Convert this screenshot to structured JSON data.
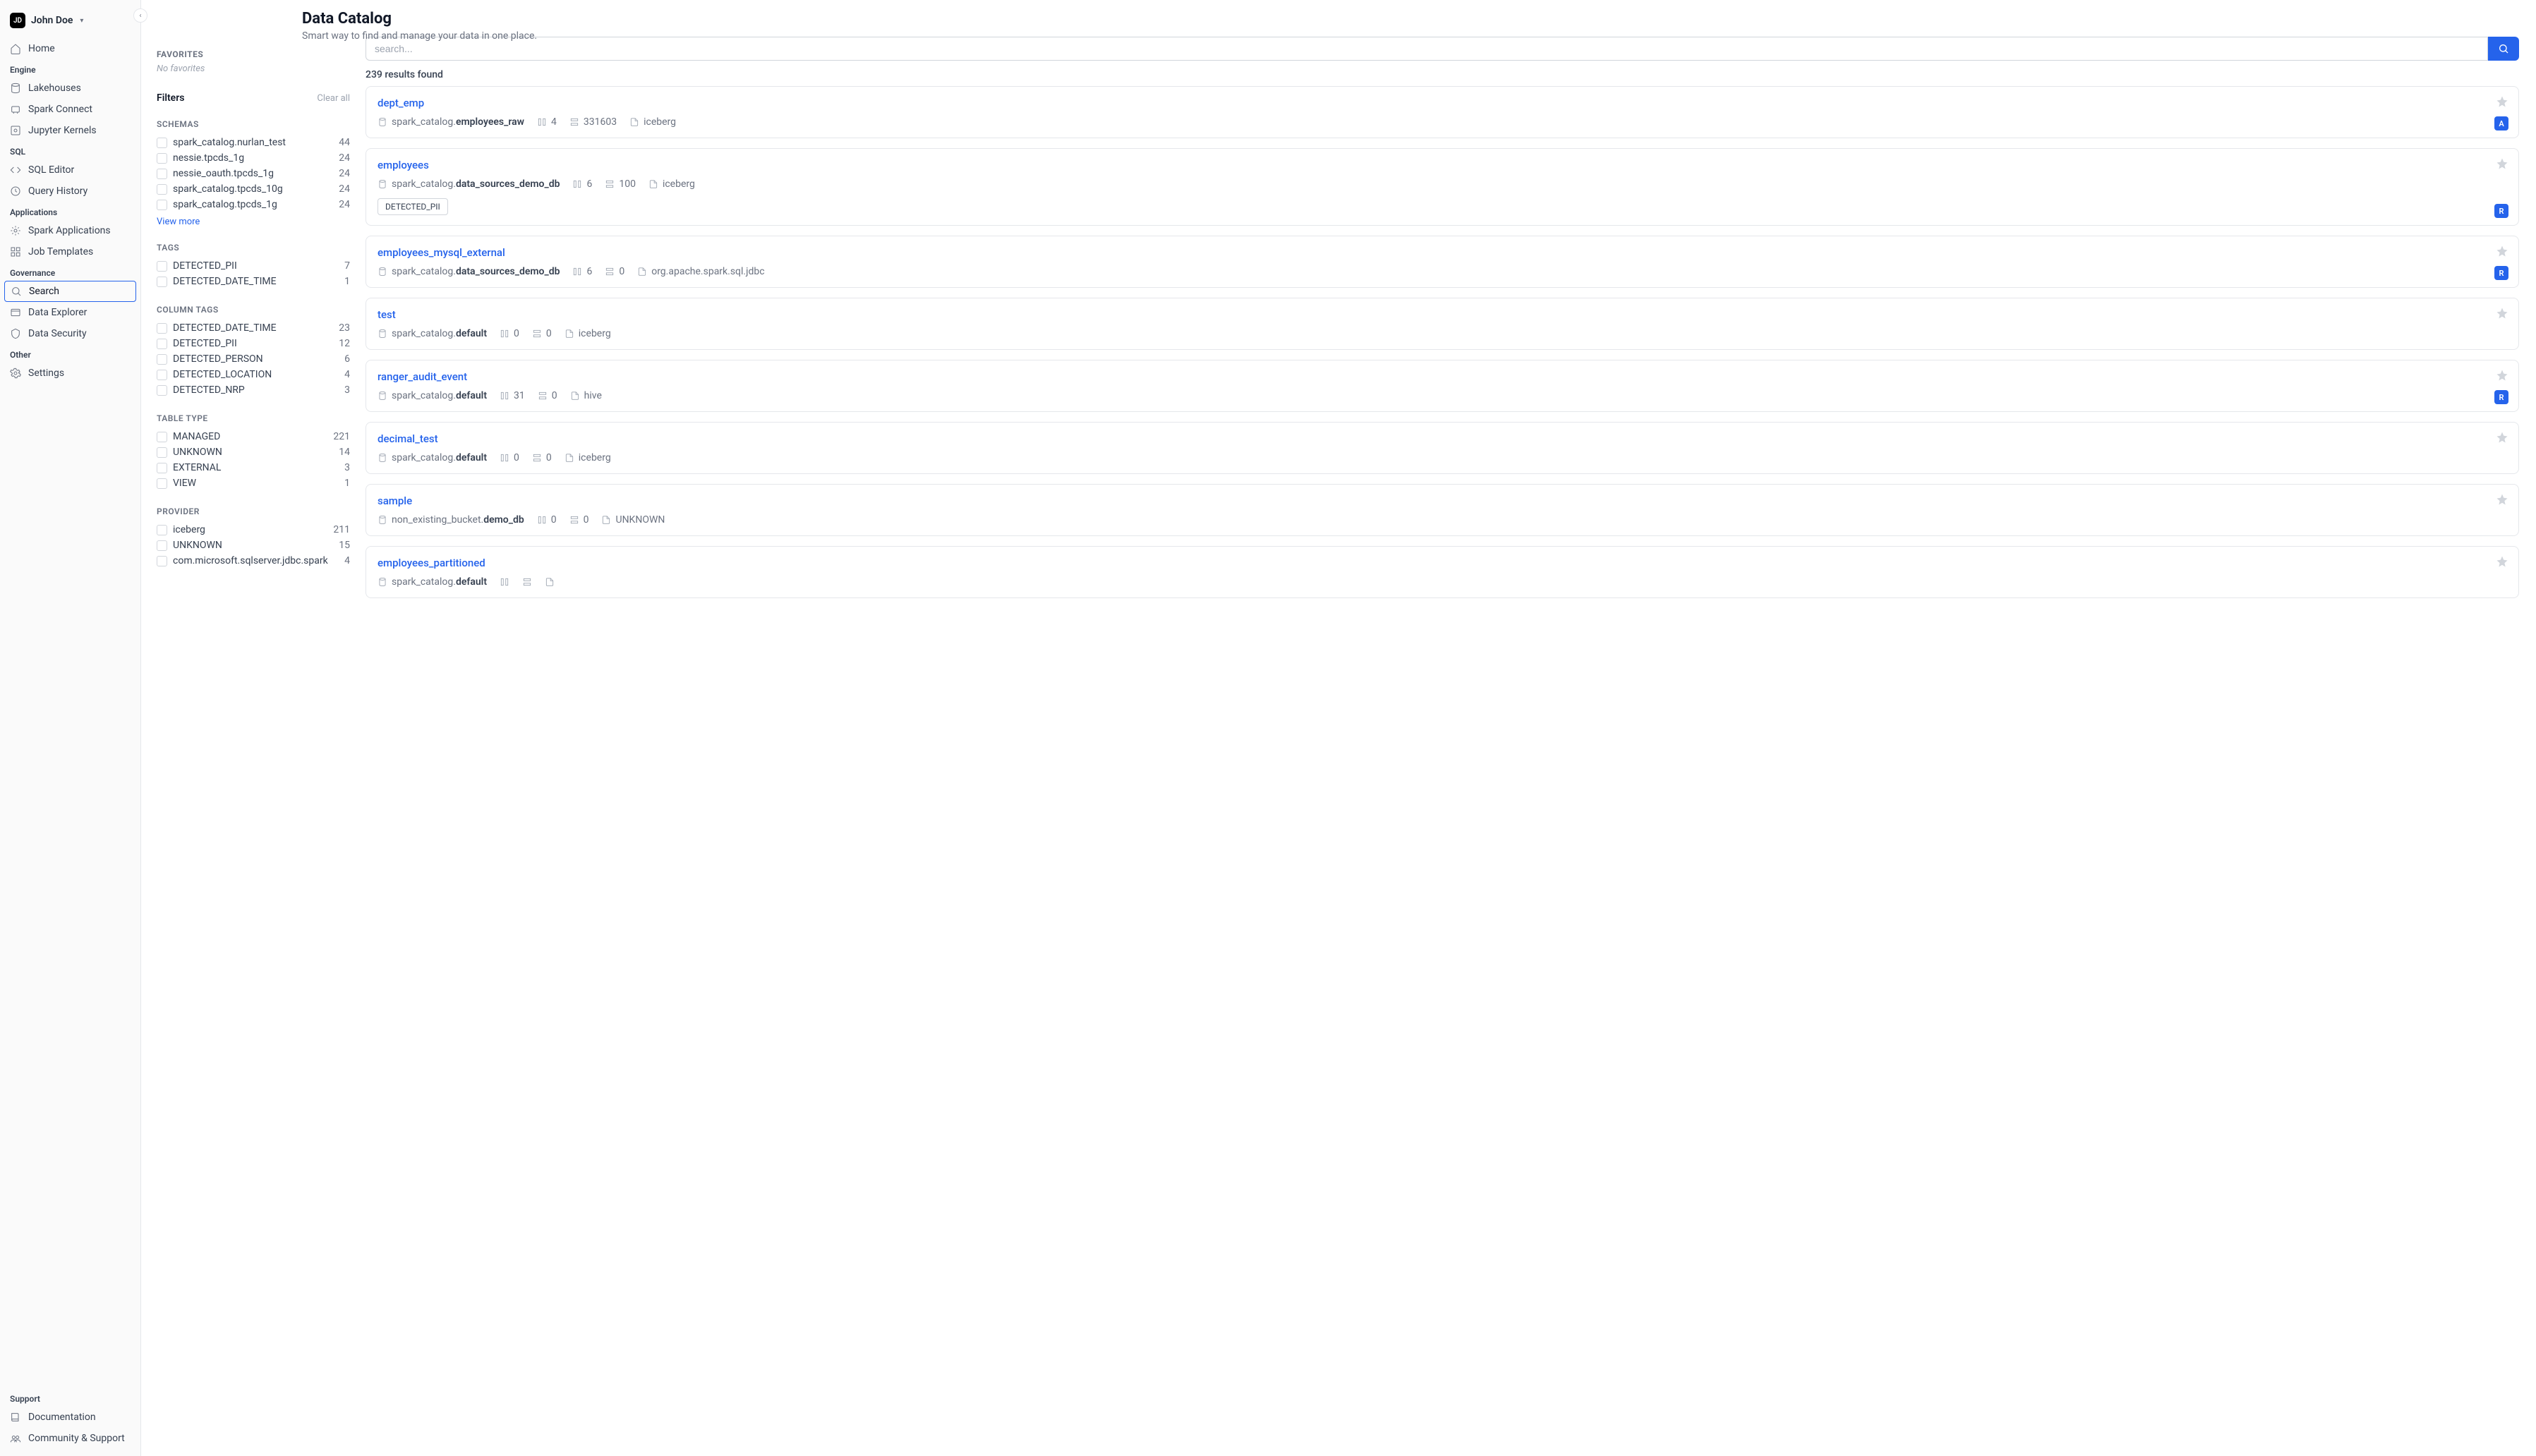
{
  "user": {
    "initials": "JD",
    "name": "John Doe"
  },
  "sidebar": {
    "home": "Home",
    "sections": {
      "engine": {
        "label": "Engine",
        "items": [
          {
            "label": "Lakehouses",
            "icon": "database"
          },
          {
            "label": "Spark Connect",
            "icon": "plug"
          },
          {
            "label": "Jupyter Kernels",
            "icon": "kernel"
          }
        ]
      },
      "sql": {
        "label": "SQL",
        "items": [
          {
            "label": "SQL Editor",
            "icon": "code"
          },
          {
            "label": "Query History",
            "icon": "clock"
          }
        ]
      },
      "applications": {
        "label": "Applications",
        "items": [
          {
            "label": "Spark Applications",
            "icon": "app"
          },
          {
            "label": "Job Templates",
            "icon": "template"
          }
        ]
      },
      "governance": {
        "label": "Governance",
        "items": [
          {
            "label": "Search",
            "icon": "search",
            "active": true
          },
          {
            "label": "Data Explorer",
            "icon": "explorer"
          },
          {
            "label": "Data Security",
            "icon": "shield"
          }
        ]
      },
      "other": {
        "label": "Other",
        "items": [
          {
            "label": "Settings",
            "icon": "gear"
          }
        ]
      },
      "support": {
        "label": "Support",
        "items": [
          {
            "label": "Documentation",
            "icon": "book"
          },
          {
            "label": "Community & Support",
            "icon": "community"
          }
        ]
      }
    }
  },
  "page": {
    "title": "Data Catalog",
    "subtitle": "Smart way to find and manage your data in one place."
  },
  "favorites": {
    "header": "FAVORITES",
    "empty": "No favorites"
  },
  "filters": {
    "title": "Filters",
    "clear": "Clear all",
    "view_more": "View more",
    "groups": [
      {
        "label": "SCHEMAS",
        "more": true,
        "items": [
          {
            "name": "spark_catalog.nurlan_test",
            "count": 44
          },
          {
            "name": "nessie.tpcds_1g",
            "count": 24
          },
          {
            "name": "nessie_oauth.tpcds_1g",
            "count": 24
          },
          {
            "name": "spark_catalog.tpcds_10g",
            "count": 24
          },
          {
            "name": "spark_catalog.tpcds_1g",
            "count": 24
          }
        ]
      },
      {
        "label": "TAGS",
        "items": [
          {
            "name": "DETECTED_PII",
            "count": 7
          },
          {
            "name": "DETECTED_DATE_TIME",
            "count": 1
          }
        ]
      },
      {
        "label": "COLUMN TAGS",
        "items": [
          {
            "name": "DETECTED_DATE_TIME",
            "count": 23
          },
          {
            "name": "DETECTED_PII",
            "count": 12
          },
          {
            "name": "DETECTED_PERSON",
            "count": 6
          },
          {
            "name": "DETECTED_LOCATION",
            "count": 4
          },
          {
            "name": "DETECTED_NRP",
            "count": 3
          }
        ]
      },
      {
        "label": "TABLE TYPE",
        "items": [
          {
            "name": "MANAGED",
            "count": 221
          },
          {
            "name": "UNKNOWN",
            "count": 14
          },
          {
            "name": "EXTERNAL",
            "count": 3
          },
          {
            "name": "VIEW",
            "count": 1
          }
        ]
      },
      {
        "label": "PROVIDER",
        "items": [
          {
            "name": "iceberg",
            "count": 211
          },
          {
            "name": "UNKNOWN",
            "count": 15
          },
          {
            "name": "com.microsoft.sqlserver.jdbc.spark",
            "count": 4
          }
        ]
      }
    ]
  },
  "search": {
    "placeholder": "search...",
    "results_count": "239 results found"
  },
  "results": [
    {
      "name": "dept_emp",
      "schema_prefix": "spark_catalog.",
      "schema_bold": "employees_raw",
      "cols": "4",
      "rows": "331603",
      "provider": "iceberg",
      "badge": "A"
    },
    {
      "name": "employees",
      "schema_prefix": "spark_catalog.",
      "schema_bold": "data_sources_demo_db",
      "cols": "6",
      "rows": "100",
      "provider": "iceberg",
      "tags": [
        "DETECTED_PII"
      ],
      "badge": "R"
    },
    {
      "name": "employees_mysql_external",
      "schema_prefix": "spark_catalog.",
      "schema_bold": "data_sources_demo_db",
      "cols": "6",
      "rows": "0",
      "provider": "org.apache.spark.sql.jdbc",
      "badge": "R"
    },
    {
      "name": "test",
      "schema_prefix": "spark_catalog.",
      "schema_bold": "default",
      "cols": "0",
      "rows": "0",
      "provider": "iceberg"
    },
    {
      "name": "ranger_audit_event",
      "schema_prefix": "spark_catalog.",
      "schema_bold": "default",
      "cols": "31",
      "rows": "0",
      "provider": "hive",
      "badge": "R"
    },
    {
      "name": "decimal_test",
      "schema_prefix": "spark_catalog.",
      "schema_bold": "default",
      "cols": "0",
      "rows": "0",
      "provider": "iceberg"
    },
    {
      "name": "sample",
      "schema_prefix": "non_existing_bucket.",
      "schema_bold": "demo_db",
      "cols": "0",
      "rows": "0",
      "provider": "UNKNOWN"
    },
    {
      "name": "employees_partitioned",
      "schema_prefix": "spark_catalog.",
      "schema_bold": "default",
      "cols": "",
      "rows": "",
      "provider": ""
    }
  ]
}
